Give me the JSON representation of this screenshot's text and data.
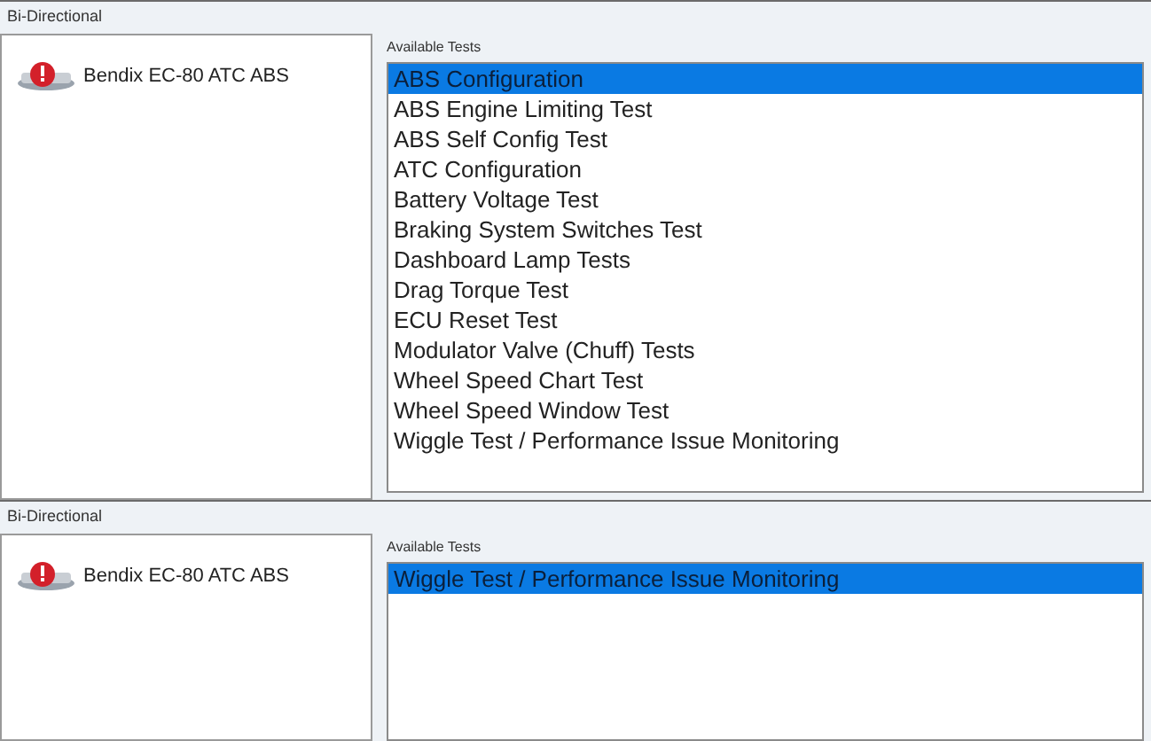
{
  "panels": [
    {
      "title": "Bi-Directional",
      "device": "Bendix EC-80 ATC ABS",
      "list_label": "Available Tests",
      "tests": [
        {
          "label": "ABS Configuration",
          "selected": true
        },
        {
          "label": "ABS Engine Limiting Test",
          "selected": false
        },
        {
          "label": "ABS Self Config Test",
          "selected": false
        },
        {
          "label": "ATC Configuration",
          "selected": false
        },
        {
          "label": "Battery Voltage Test",
          "selected": false
        },
        {
          "label": "Braking System Switches Test",
          "selected": false
        },
        {
          "label": "Dashboard Lamp Tests",
          "selected": false
        },
        {
          "label": "Drag Torque Test",
          "selected": false
        },
        {
          "label": "ECU Reset Test",
          "selected": false
        },
        {
          "label": "Modulator Valve (Chuff) Tests",
          "selected": false
        },
        {
          "label": "Wheel Speed Chart Test",
          "selected": false
        },
        {
          "label": "Wheel Speed Window Test",
          "selected": false
        },
        {
          "label": "Wiggle Test / Performance Issue Monitoring",
          "selected": false
        }
      ]
    },
    {
      "title": "Bi-Directional",
      "device": "Bendix EC-80 ATC ABS",
      "list_label": "Available Tests",
      "tests": [
        {
          "label": "Wiggle Test / Performance Issue Monitoring",
          "selected": true
        }
      ]
    }
  ]
}
